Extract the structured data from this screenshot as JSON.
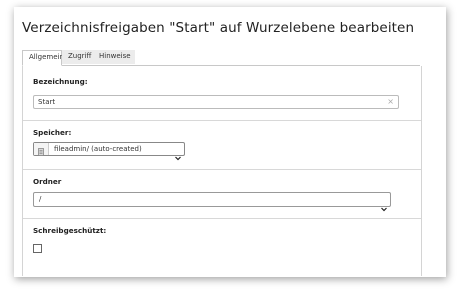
{
  "page": {
    "title": "Verzeichnisfreigaben \"Start\" auf Wurzelebene bearbeiten"
  },
  "tabs": [
    {
      "label": "Allgemein",
      "active": true
    },
    {
      "label": "Zugriff",
      "active": false
    },
    {
      "label": "Hinweise",
      "active": false
    }
  ],
  "fields": {
    "bezeichnung": {
      "label": "Bezeichnung:",
      "value": "Start"
    },
    "speicher": {
      "label": "Speicher:",
      "value": "fileadmin/ (auto-created)",
      "icon": "storage-icon"
    },
    "ordner": {
      "label": "Ordner",
      "value": "/"
    },
    "schreibgeschuetzt": {
      "label": "Schreibgeschützt:",
      "checked": false
    }
  }
}
